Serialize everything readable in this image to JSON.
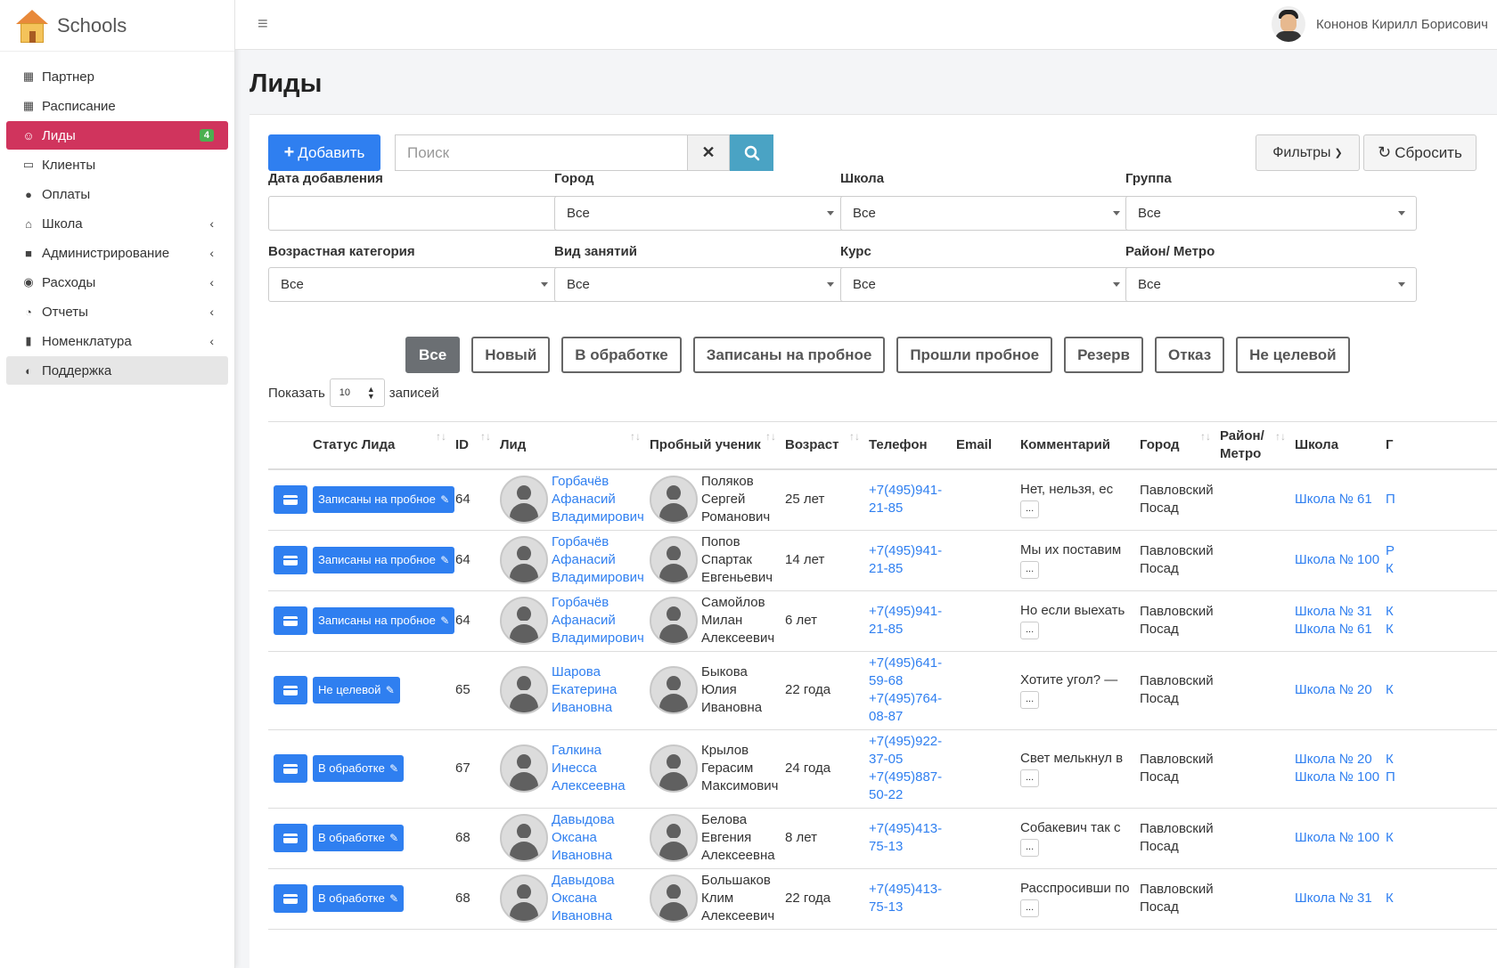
{
  "brand": {
    "title": "Schools"
  },
  "sidebar": {
    "items": [
      {
        "label": "Партнер",
        "icon": "building-icon"
      },
      {
        "label": "Расписание",
        "icon": "calendar-icon"
      },
      {
        "label": "Лиды",
        "icon": "users-icon",
        "badge": "4",
        "active": true
      },
      {
        "label": "Клиенты",
        "icon": "id-card-icon"
      },
      {
        "label": "Оплаты",
        "icon": "money-bag-icon"
      },
      {
        "label": "Школа",
        "icon": "school-icon",
        "expandable": true
      },
      {
        "label": "Администрирование",
        "icon": "truck-icon",
        "expandable": true
      },
      {
        "label": "Расходы",
        "icon": "piggy-bank-icon",
        "expandable": true
      },
      {
        "label": "Отчеты",
        "icon": "pie-chart-icon",
        "expandable": true
      },
      {
        "label": "Номенклатура",
        "icon": "book-icon",
        "expandable": true
      },
      {
        "label": "Поддержка",
        "icon": "headset-icon"
      }
    ]
  },
  "header": {
    "user_name": "Кононов Кирилл Борисович"
  },
  "page": {
    "title": "Лиды"
  },
  "toolbar": {
    "add_label": "Добавить",
    "search_placeholder": "Поиск",
    "filters_label": "Фильтры",
    "reset_label": "Сбросить"
  },
  "filters": {
    "date_label": "Дата добавления",
    "date_value": "",
    "city_label": "Город",
    "city_value": "Все",
    "school_label": "Школа",
    "school_value": "Все",
    "group_label": "Группа",
    "group_value": "Все",
    "age_label": "Возрастная категория",
    "age_value": "Все",
    "kind_label": "Вид занятий",
    "kind_value": "Все",
    "course_label": "Курс",
    "course_value": "Все",
    "district_label": "Район/ Метро",
    "district_value": "Все"
  },
  "status_tabs": [
    "Все",
    "Новый",
    "В обработке",
    "Записаны на пробное",
    "Прошли пробное",
    "Резерв",
    "Отказ",
    "Не целевой"
  ],
  "paging": {
    "show_label": "Показать",
    "page_size": "10",
    "records_label": "записей"
  },
  "table": {
    "columns": [
      "Статус Лида",
      "ID",
      "Лид",
      "Пробный ученик",
      "Возраст",
      "Телефон",
      "Email",
      "Комментарий",
      "Город",
      "Район/ Метро",
      "Школа",
      "Г"
    ],
    "rows": [
      {
        "status": "Записаны на пробное",
        "id": "64",
        "lead": [
          "Горбачёв",
          "Афанасий",
          "Владимирович"
        ],
        "student": [
          "Поляков",
          "Сергей",
          "Романович"
        ],
        "age": "25 лет",
        "phones": [
          "+7(495)941-",
          "21-85"
        ],
        "email": "",
        "comment": "Нет, нельзя, ес",
        "city": [
          "Павловский",
          "Посад"
        ],
        "district": "",
        "schools": [
          "Школа № 61"
        ],
        "group": [
          "П"
        ]
      },
      {
        "status": "Записаны на пробное",
        "id": "64",
        "lead": [
          "Горбачёв",
          "Афанасий",
          "Владимирович"
        ],
        "student": [
          "Попов",
          "Спартак",
          "Евгеньевич"
        ],
        "age": "14 лет",
        "phones": [
          "+7(495)941-",
          "21-85"
        ],
        "email": "",
        "comment": "Мы их поставим",
        "city": [
          "Павловский",
          "Посад"
        ],
        "district": "",
        "schools": [
          "Школа № 100"
        ],
        "group": [
          "Р",
          "К"
        ]
      },
      {
        "status": "Записаны на пробное",
        "id": "64",
        "lead": [
          "Горбачёв",
          "Афанасий",
          "Владимирович"
        ],
        "student": [
          "Самойлов",
          "Милан",
          "Алексеевич"
        ],
        "age": "6 лет",
        "phones": [
          "+7(495)941-",
          "21-85"
        ],
        "email": "",
        "comment": "Но если выехать",
        "city": [
          "Павловский",
          "Посад"
        ],
        "district": "",
        "schools": [
          "Школа № 31",
          "Школа № 61"
        ],
        "group": [
          "К",
          "К"
        ]
      },
      {
        "status": "Не целевой",
        "id": "65",
        "lead": [
          "Шарова",
          "Екатерина",
          "Ивановна"
        ],
        "student": [
          "Быкова",
          "Юлия",
          "Ивановна"
        ],
        "age": "22 года",
        "phones": [
          "+7(495)641-",
          "59-68",
          "+7(495)764-",
          "08-87"
        ],
        "email": "",
        "comment": "Хотите угол? —",
        "city": [
          "Павловский",
          "Посад"
        ],
        "district": "",
        "schools": [
          "Школа № 20"
        ],
        "group": [
          "К"
        ]
      },
      {
        "status": "В обработке",
        "id": "67",
        "lead": [
          "Галкина",
          "Инесса",
          "Алексеевна"
        ],
        "student": [
          "Крылов",
          "Герасим",
          "Максимович"
        ],
        "age": "24 года",
        "phones": [
          "+7(495)922-",
          "37-05",
          "+7(495)887-",
          "50-22"
        ],
        "email": "",
        "comment": "Свет мелькнул в",
        "city": [
          "Павловский",
          "Посад"
        ],
        "district": "",
        "schools": [
          "Школа № 20",
          "Школа № 100"
        ],
        "group": [
          "К",
          "П"
        ]
      },
      {
        "status": "В обработке",
        "id": "68",
        "lead": [
          "Давыдова",
          "Оксана",
          "Ивановна"
        ],
        "student": [
          "Белова",
          "Евгения",
          "Алексеевна"
        ],
        "age": "8 лет",
        "phones": [
          "+7(495)413-",
          "75-13"
        ],
        "email": "",
        "comment": "Собакевич так с",
        "city": [
          "Павловский",
          "Посад"
        ],
        "district": "",
        "schools": [
          "Школа № 100"
        ],
        "group": [
          "К"
        ]
      },
      {
        "status": "В обработке",
        "id": "68",
        "lead": [
          "Давыдова",
          "Оксана",
          "Ивановна"
        ],
        "student": [
          "Большаков",
          "Клим",
          "Алексеевич"
        ],
        "age": "22 года",
        "phones": [
          "+7(495)413-",
          "75-13"
        ],
        "email": "",
        "comment": "Расспросивши по",
        "city": [
          "Павловский",
          "Посад"
        ],
        "district": "",
        "schools": [
          "Школа № 31"
        ],
        "group": [
          "К"
        ]
      }
    ],
    "comment_more": "..."
  },
  "colors": {
    "primary": "#2f7ff0",
    "active_nav": "#d0345d",
    "badge": "#4caf50",
    "search_btn": "#4aa3c4"
  }
}
